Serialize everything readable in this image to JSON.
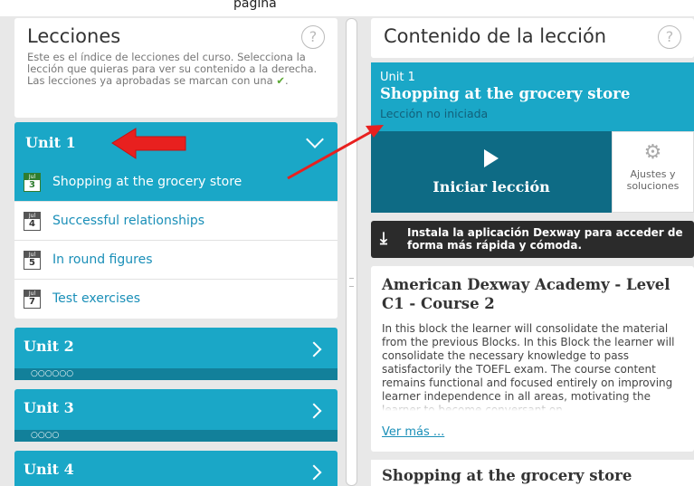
{
  "top_text": "página",
  "left": {
    "title": "Lecciones",
    "help": "?",
    "intro": "Este es el índice de lecciones del curso. Selecciona la lección que quieras para ver su contenido a la derecha. Las lecciones ya aprobadas se marcan con una",
    "check": "✔",
    "intro_end": ".",
    "unit1": {
      "name": "Unit 1",
      "lessons": [
        {
          "day": "3",
          "month": "Jul",
          "title": "Shopping at the grocery store"
        },
        {
          "day": "4",
          "month": "Jul",
          "title": "Successful relationships"
        },
        {
          "day": "5",
          "month": "Jul",
          "title": "In round figures"
        },
        {
          "day": "7",
          "month": "Jul",
          "title": "Test exercises"
        }
      ]
    },
    "units": [
      {
        "name": "Unit 2",
        "dots": "○○○○○○"
      },
      {
        "name": "Unit 3",
        "dots": "○○○○"
      },
      {
        "name": "Unit 4",
        "dots": ""
      }
    ]
  },
  "right": {
    "title": "Contenido de la lección",
    "help": "?",
    "lesson_unit": "Unit 1",
    "lesson_title": "Shopping at the grocery store",
    "lesson_status": "Lección no iniciada",
    "start_label": "Iniciar lección",
    "settings_label_1": "Ajustes y",
    "settings_label_2": "soluciones",
    "install_text": "Instala la aplicación Dexway para acceder de forma más rápida y cómoda.",
    "course_title": "American Dexway Academy - Level C1 - Course 2",
    "course_desc": "In this block the learner will consolidate the material from the previous Blocks. In this Block the learner will consolidate the necessary knowledge to pass satisfactorily the TOEFL exam. The course content remains functional and focused entirely on improving learner independence in all areas, motivating the learner to become conversant on",
    "more_label": "Ver más ...",
    "next_title": "Shopping at the grocery store"
  },
  "colors": {
    "accent": "#1aa7c7",
    "dark_accent": "#0e6b85",
    "annotation": "#e8201f"
  }
}
